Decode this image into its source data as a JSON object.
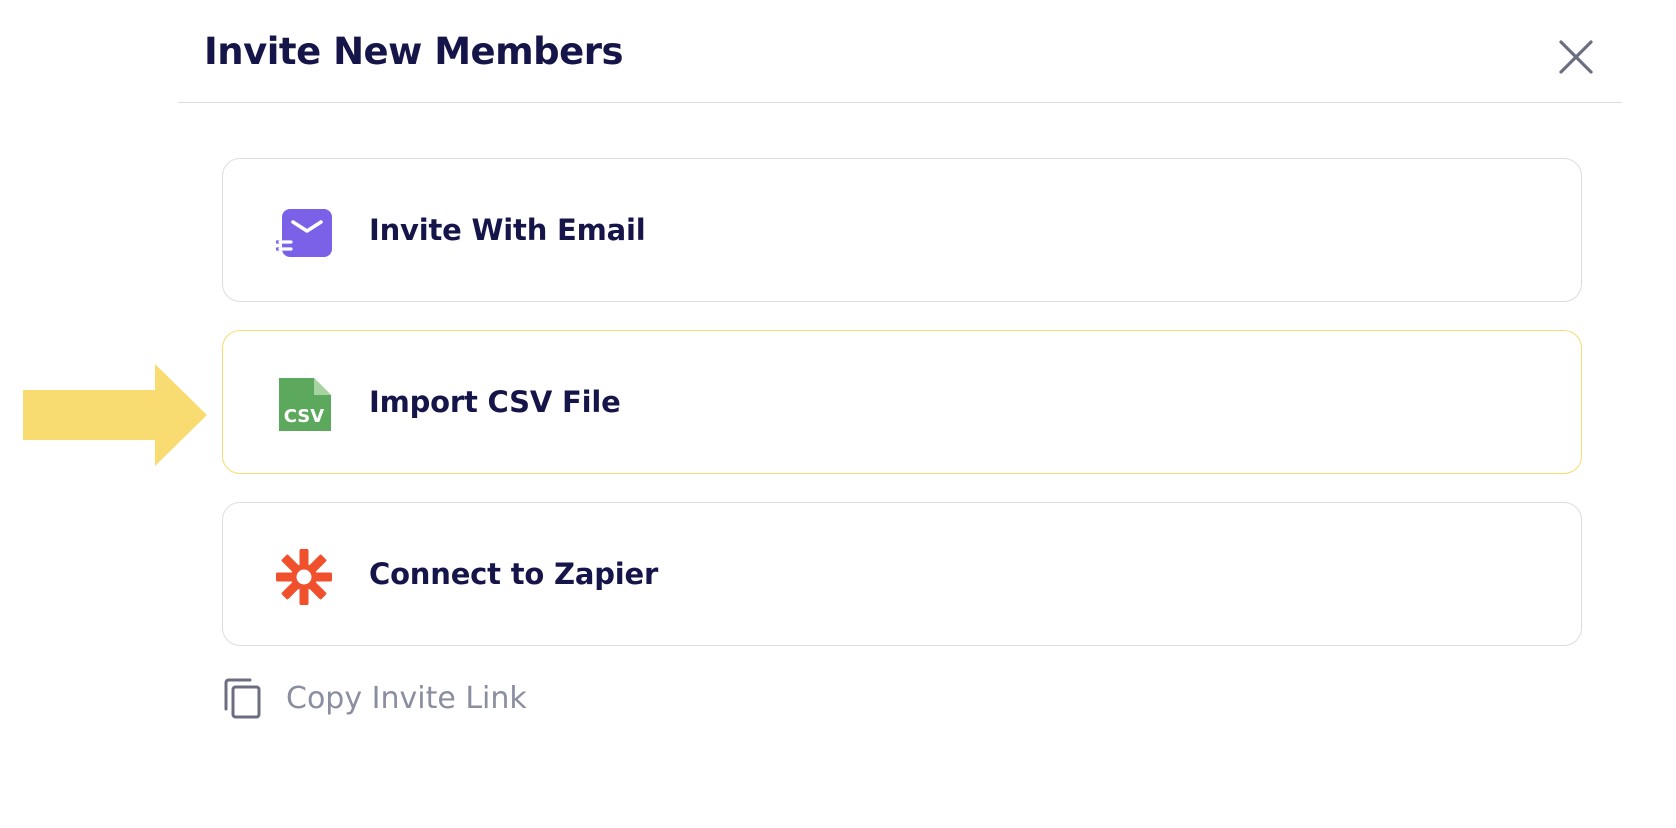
{
  "modal": {
    "title": "Invite New Members",
    "close_icon": "close-icon"
  },
  "options": [
    {
      "label": "Invite With Email",
      "icon": "email-icon",
      "icon_color": "#7b61e8"
    },
    {
      "label": "Import CSV File",
      "icon": "csv-file-icon",
      "icon_color": "#5ca85c",
      "icon_text": "CSV",
      "highlighted": true
    },
    {
      "label": "Connect to Zapier",
      "icon": "zapier-icon",
      "icon_color": "#f0502c"
    }
  ],
  "copy_link": {
    "label": "Copy Invite Link",
    "icon": "copy-icon"
  },
  "annotation": {
    "pointer": "arrow-right-icon",
    "color": "#f8dc72"
  },
  "colors": {
    "title": "#16154a",
    "muted_text": "#8b8ea0",
    "border": "#dcdde3",
    "highlight_border": "#f6dc72"
  }
}
